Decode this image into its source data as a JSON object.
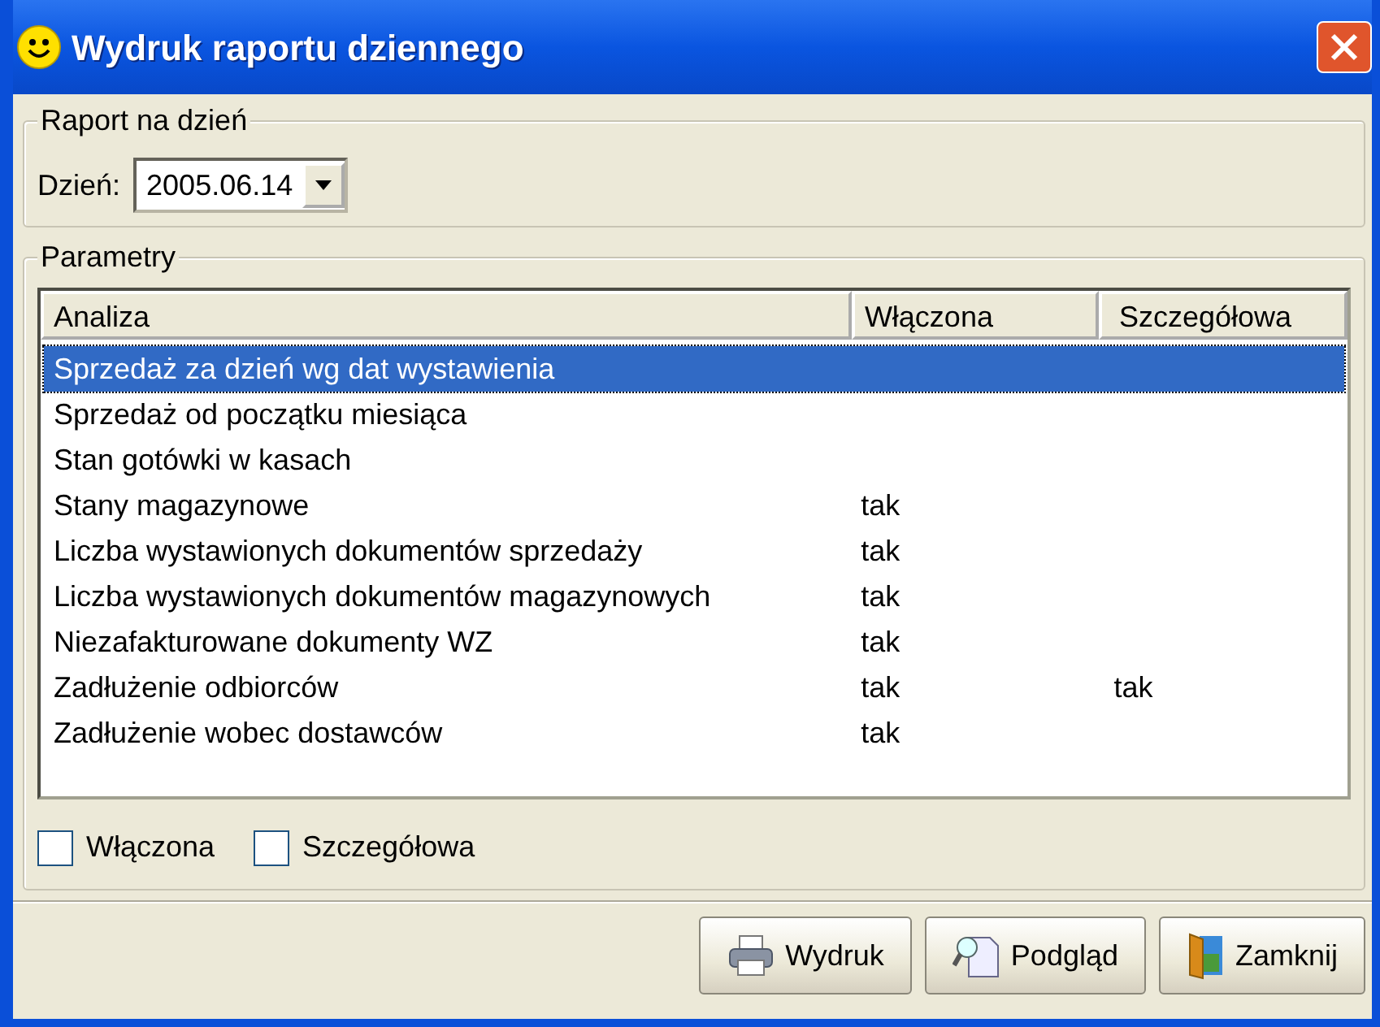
{
  "window": {
    "title": "Wydruk raportu dziennego"
  },
  "date_group": {
    "title": "Raport na dzień",
    "label": "Dzień:",
    "value": "2005.06.14"
  },
  "params_group": {
    "title": "Parametry"
  },
  "table": {
    "columns": [
      "Analiza",
      "Włączona",
      "Szczegółowa"
    ],
    "rows": [
      {
        "cells": [
          "Sprzedaż za dzień wg dat wystawienia",
          "",
          ""
        ],
        "selected": true
      },
      {
        "cells": [
          "Sprzedaż od początku miesiąca",
          "",
          ""
        ],
        "selected": false
      },
      {
        "cells": [
          "Stan gotówki w kasach",
          "",
          ""
        ],
        "selected": false
      },
      {
        "cells": [
          "Stany magazynowe",
          "tak",
          ""
        ],
        "selected": false
      },
      {
        "cells": [
          "Liczba wystawionych dokumentów sprzedaży",
          "tak",
          ""
        ],
        "selected": false
      },
      {
        "cells": [
          "Liczba wystawionych dokumentów magazynowych",
          "tak",
          ""
        ],
        "selected": false
      },
      {
        "cells": [
          "Niezafakturowane dokumenty WZ",
          "tak",
          ""
        ],
        "selected": false
      },
      {
        "cells": [
          "Zadłużenie odbiorców",
          "tak",
          "tak"
        ],
        "selected": false
      },
      {
        "cells": [
          "Zadłużenie wobec dostawców",
          "tak",
          ""
        ],
        "selected": false
      }
    ]
  },
  "checkboxes": [
    {
      "label": "Włączona",
      "checked": false
    },
    {
      "label": "Szczegółowa",
      "checked": false
    }
  ],
  "buttons": [
    {
      "label": "Wydruk",
      "kind": "print"
    },
    {
      "label": "Podgląd",
      "kind": "preview"
    },
    {
      "label": "Zamknij",
      "kind": "close"
    }
  ]
}
